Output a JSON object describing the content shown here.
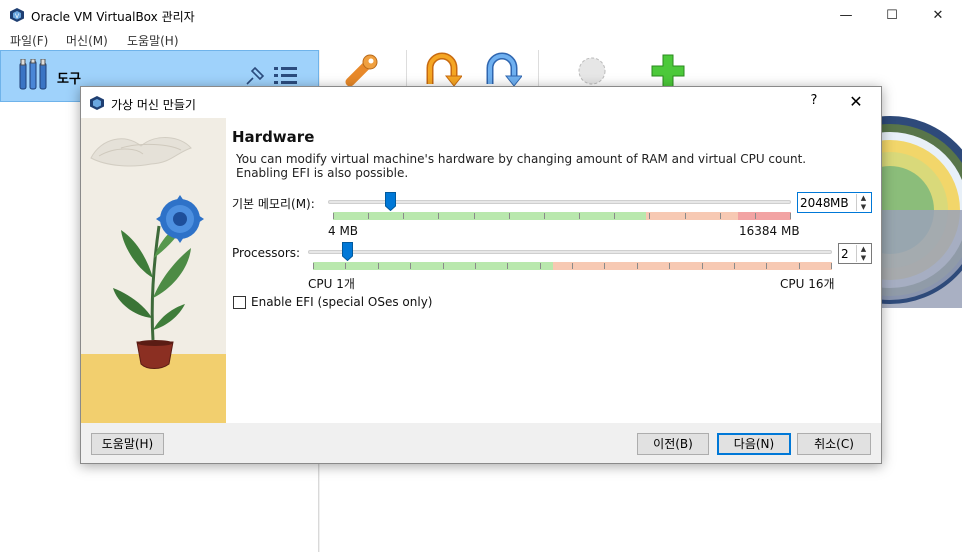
{
  "window": {
    "title": "Oracle VM VirtualBox 관리자",
    "minimize": "—",
    "maximize": "☐",
    "close": "✕"
  },
  "menu": [
    "파일(F)",
    "머신(M)",
    "도움말(H)"
  ],
  "sidebar": {
    "tools_label": "도구"
  },
  "dialog": {
    "title": "가상 머신 만들기",
    "help": "?",
    "close": "✕",
    "heading": "Hardware",
    "description_line1": "You can modify virtual machine's hardware by changing amount of RAM and virtual CPU count.",
    "description_line2": "Enabling EFI is also possible.",
    "memory": {
      "label": "기본 메모리(M):",
      "value": "2048",
      "unit": "MB",
      "min_label": "4 MB",
      "max_label": "16384 MB",
      "level": 0.125
    },
    "processors": {
      "label": "Processors:",
      "value": "2",
      "min_label": "CPU 1개",
      "max_label": "CPU 16개",
      "level": 0.0667
    },
    "efi": {
      "label": "Enable EFI (special OSes only)",
      "checked": false
    },
    "buttons": {
      "help": "도움말(H)",
      "back": "이전(B)",
      "next": "다음(N)",
      "cancel": "취소(C)"
    }
  },
  "colors": {
    "accent": "#0078d7",
    "sidebar_selected": "#9fd2fb",
    "scale_green": "#b9e8ad",
    "scale_orange": "#f7c9b3",
    "scale_red": "#f2a3a3"
  }
}
